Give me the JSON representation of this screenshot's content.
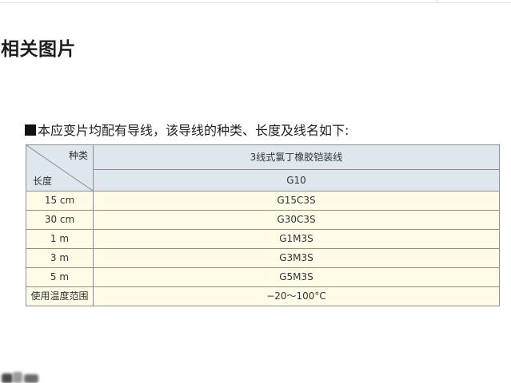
{
  "section_title": "相关图片",
  "intro_text": "本应变片均配有导线，该导线的种类、长度及线名如下:",
  "table": {
    "corner_top": "种类",
    "corner_bottom": "长度",
    "header_type": "3线式氯丁橡胶铠装线",
    "header_code": "G10",
    "rows": [
      {
        "length": "15 cm",
        "name": "G15C3S"
      },
      {
        "length": "30 cm",
        "name": "G30C3S"
      },
      {
        "length": "1 m",
        "name": "G1M3S"
      },
      {
        "length": "3 m",
        "name": "G3M3S"
      },
      {
        "length": "5 m",
        "name": "G5M3S"
      }
    ],
    "temp_label": "使用温度范围",
    "temp_value": "−20〜100°C"
  },
  "colors": {
    "header_bg": "#dfe7ee",
    "body_bg": "#fffbe6",
    "border": "#8f8f8f"
  }
}
